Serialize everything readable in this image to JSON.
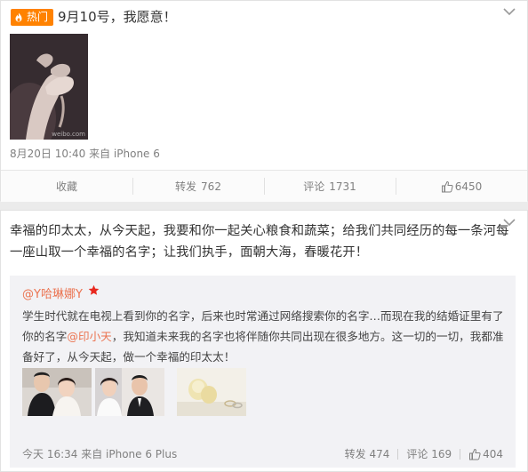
{
  "post1": {
    "badge": "热门",
    "title": "9月10号，我愿意！",
    "thumb_watermark": "weibo.com",
    "meta": "8月20日 10:40 来自 iPhone 6",
    "actions": {
      "favorite": "收藏",
      "repost": "转发",
      "repost_count": "762",
      "comment": "评论",
      "comment_count": "1731",
      "like_count": "6450"
    }
  },
  "post2": {
    "text": "幸福的印太太，从今天起，我要和你一起关心粮食和蔬菜；给我们共同经历的每一条河每一座山取一个幸福的名字；让我们执手，面朝大海，春暖花开！",
    "quote": {
      "user": "@Y哈琳娜Y",
      "text_before": "学生时代就在电视上看到你的名字，后来也时常通过网络搜索你的名字…而现在我的结婚证里有了你的名字",
      "mention": "@印小天",
      "text_after": "，我知道未来我的名字也将伴随你共同出现在很多地方。这一切的一切，我都准备好了，从今天起，做一个幸福的印太太！",
      "meta": "今天 16:34 来自 iPhone 6 Plus",
      "repost": "转发",
      "repost_count": "474",
      "comment": "评论",
      "comment_count": "169",
      "like_count": "404"
    }
  },
  "colors": {
    "hot_orange": "#ff8200",
    "mention": "#eb7350",
    "meta_gray": "#808080"
  },
  "icons": [
    "fire-icon",
    "chevron-down-icon",
    "thumbs-up-icon",
    "star-badge-icon"
  ]
}
